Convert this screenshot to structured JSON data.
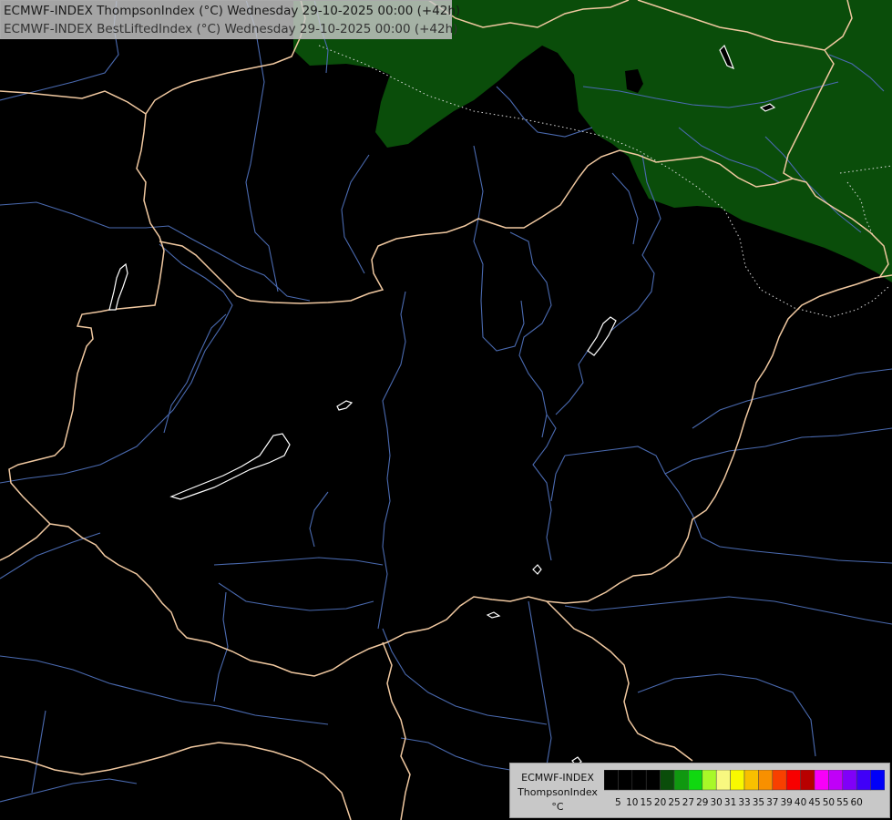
{
  "header": {
    "line1": "ECMWF-INDEX ThompsonIndex (°C) Wednesday 29-10-2025 00:00 (+42h)",
    "line2": "ECMWF-INDEX BestLiftedIndex (°C) Wednesday 29-10-2025 00:00 (+42h)"
  },
  "legend": {
    "model": "ECMWF-INDEX",
    "variable": "ThompsonIndex",
    "unit": "°C",
    "ticks": [
      "5",
      "10",
      "15",
      "20",
      "25",
      "27",
      "29",
      "30",
      "31",
      "33",
      "35",
      "37",
      "39",
      "40",
      "45",
      "50",
      "55",
      "60"
    ],
    "colors": [
      "#000000",
      "#000000",
      "#000000",
      "#000000",
      "#0a4d0a",
      "#109810",
      "#10d810",
      "#a8f828",
      "#f8f880",
      "#f8f800",
      "#f8c000",
      "#f89000",
      "#f84000",
      "#f80000",
      "#b80000",
      "#f800f8",
      "#c000f8",
      "#8000f8",
      "#4000f8",
      "#0000f8"
    ]
  },
  "map": {
    "colors": {
      "background": "#000000",
      "shaded_area": "#0a4d0a",
      "borders": "#f0c8a0",
      "rivers": "#4a6ab0",
      "lakes": "#ffffff"
    }
  }
}
